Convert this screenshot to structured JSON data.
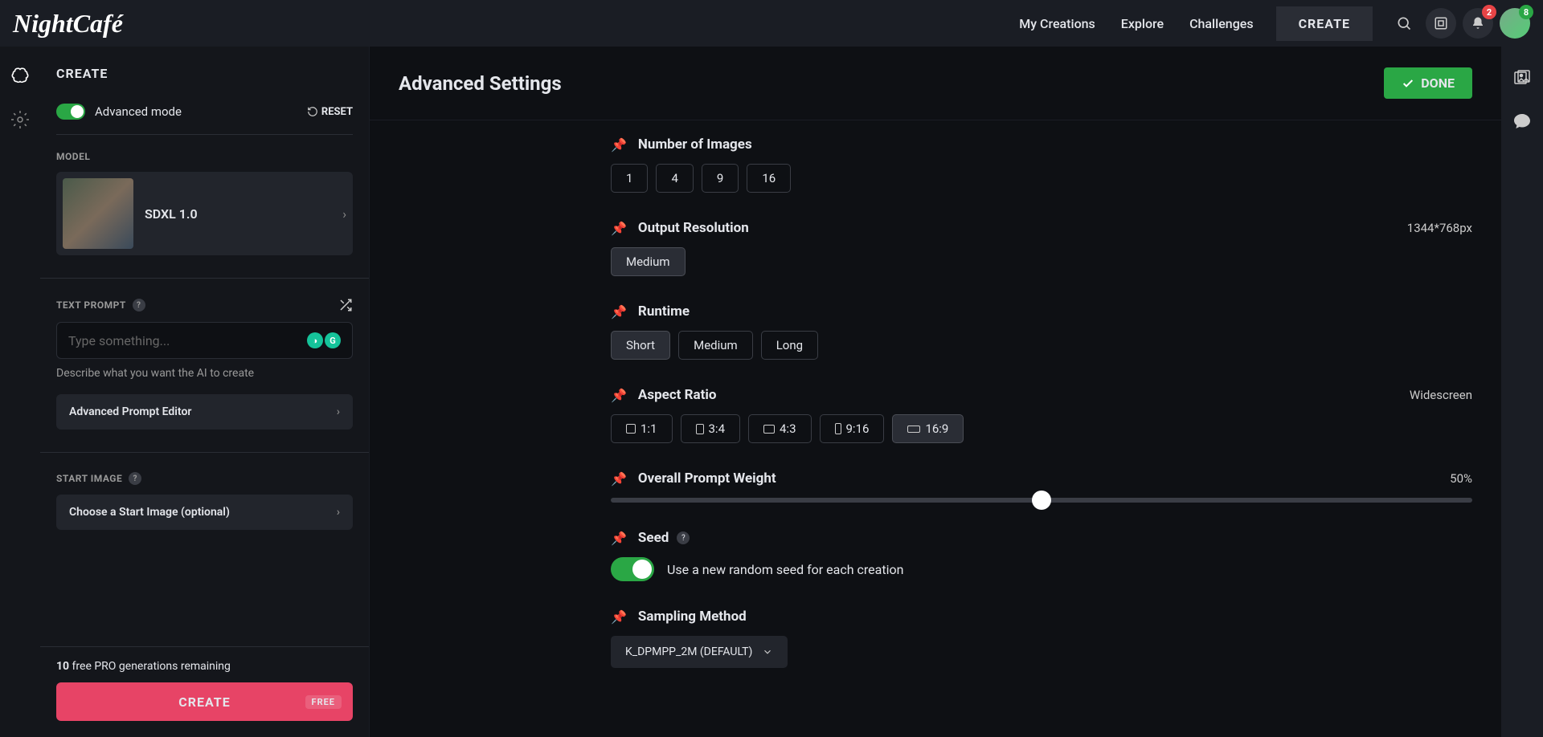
{
  "topnav": {
    "logo": "NightCafé",
    "links": [
      "My Creations",
      "Explore",
      "Challenges"
    ],
    "create_btn": "CREATE",
    "notif_badge": "2",
    "avatar_badge": "8"
  },
  "sidebar": {
    "header": "CREATE",
    "advanced_mode_label": "Advanced mode",
    "reset_label": "RESET",
    "model_section": "MODEL",
    "model_name": "SDXL 1.0",
    "text_prompt_label": "TEXT PROMPT",
    "prompt_placeholder": "Type something...",
    "prompt_help": "Describe what you want the AI to create",
    "advanced_prompt_editor": "Advanced Prompt Editor",
    "start_image_label": "START IMAGE",
    "choose_start_image": "Choose a Start Image (optional)",
    "gen_count": "10",
    "gen_remaining_text": " free PRO generations remaining",
    "create_btn": "CREATE",
    "free_tag": "FREE"
  },
  "content": {
    "title": "Advanced Settings",
    "done_btn": "DONE"
  },
  "settings": {
    "num_images": {
      "title": "Number of Images",
      "options": [
        "1",
        "4",
        "9",
        "16"
      ]
    },
    "output_res": {
      "title": "Output Resolution",
      "value": "1344*768px",
      "options": [
        "Medium"
      ]
    },
    "runtime": {
      "title": "Runtime",
      "options": [
        "Short",
        "Medium",
        "Long"
      ],
      "active": 0
    },
    "aspect": {
      "title": "Aspect Ratio",
      "value": "Widescreen",
      "options": [
        "1:1",
        "3:4",
        "4:3",
        "9:16",
        "16:9"
      ],
      "active": 4
    },
    "weight": {
      "title": "Overall Prompt Weight",
      "value": "50%",
      "percent": 50
    },
    "seed": {
      "title": "Seed",
      "desc": "Use a new random seed for each creation"
    },
    "sampling": {
      "title": "Sampling Method",
      "selected": "K_DPMPP_2M (DEFAULT)"
    }
  }
}
